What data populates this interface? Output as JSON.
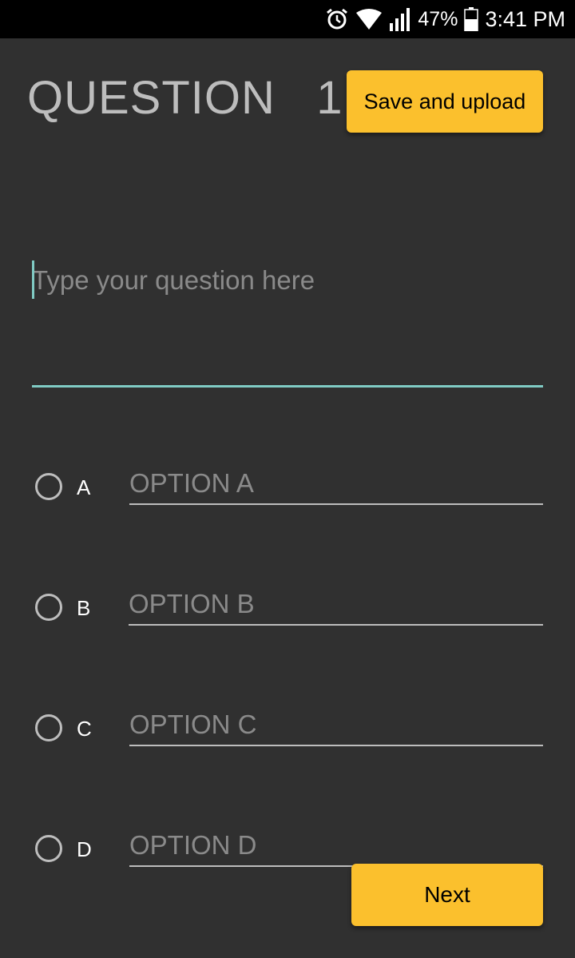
{
  "status_bar": {
    "battery_percent": "47%",
    "time": "3:41 PM",
    "icons": [
      "alarm-icon",
      "wifi-icon",
      "signal-icon",
      "battery-icon"
    ]
  },
  "header": {
    "title": "QUESTION   1",
    "save_label": "Save and upload"
  },
  "question": {
    "placeholder": "Type your question here",
    "value": ""
  },
  "options": [
    {
      "letter": "A",
      "placeholder": "OPTION A",
      "selected": false
    },
    {
      "letter": "B",
      "placeholder": "OPTION B",
      "selected": false
    },
    {
      "letter": "C",
      "placeholder": "OPTION C",
      "selected": false
    },
    {
      "letter": "D",
      "placeholder": "OPTION D",
      "selected": false
    }
  ],
  "footer": {
    "next_label": "Next"
  },
  "colors": {
    "background": "#303030",
    "accent_yellow": "#fbc02d",
    "focus_teal": "#80cbc4",
    "status_bar": "#000000"
  }
}
